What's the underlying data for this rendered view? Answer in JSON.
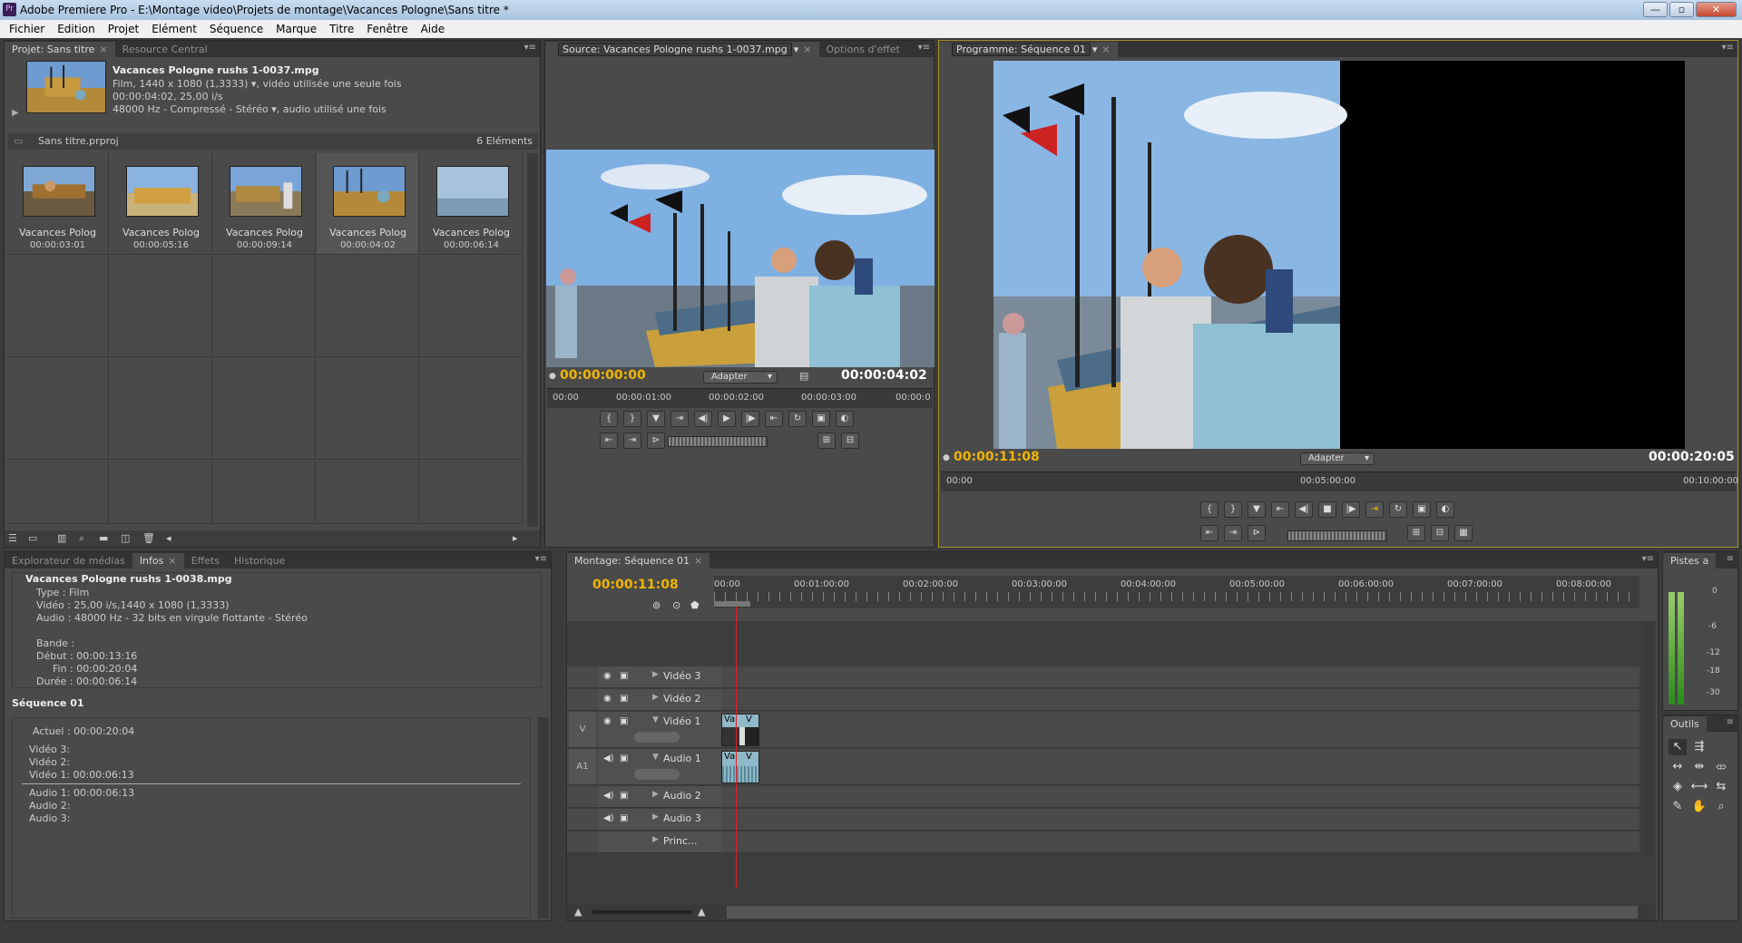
{
  "app_title": "Adobe Premiere Pro - E:\\Montage video\\Projets de montage\\Vacances Pologne\\Sans titre *",
  "app_icon": "Pr",
  "window_buttons": {
    "minimize": "—",
    "maximize": "▫",
    "close": "✕"
  },
  "menu": [
    "Fichier",
    "Edition",
    "Projet",
    "Elément",
    "Séquence",
    "Marque",
    "Titre",
    "Fenêtre",
    "Aide"
  ],
  "project": {
    "tabs": [
      "Projet: Sans titre",
      "Resource Central"
    ],
    "clip_name": "Vacances Pologne rushs 1-0037.mpg",
    "clip_line1": "Film, 1440 x 1080 (1,3333)",
    "clip_line1b": ", vidéo utilisée une seule fois",
    "clip_line2": "00:00:04:02, 25,00 i/s",
    "clip_line3": "48000 Hz - Compressé - Stéréo",
    "clip_line3b": ", audio utilisé une fois",
    "file": "Sans titre.prproj",
    "count": "6 Eléments",
    "items": [
      {
        "name": "Vacances Polog",
        "dur": "00:00:03:01"
      },
      {
        "name": "Vacances Polog",
        "dur": "00:00:05:16"
      },
      {
        "name": "Vacances Polog",
        "dur": "00:00:09:14"
      },
      {
        "name": "Vacances Polog",
        "dur": "00:00:04:02"
      },
      {
        "name": "Vacances Polog",
        "dur": "00:00:06:14"
      }
    ]
  },
  "source": {
    "tab": "Source: Vacances Pologne rushs 1-0037.mpg",
    "tab2": "Options d'effet",
    "tc_current": "00:00:00:00",
    "fit": "Adapter",
    "tc_duration": "00:00:04:02",
    "ruler": [
      "00:00",
      "00:00:01:00",
      "00:00:02:00",
      "00:00:03:00",
      "00:00:0"
    ]
  },
  "program": {
    "tab": "Programme: Séquence 01",
    "tc_current": "00:00:11:08",
    "fit": "Adapter",
    "tc_duration": "00:00:20:05",
    "ruler": [
      "00:00",
      "00:05:00:00",
      "00:10:00:00"
    ]
  },
  "info": {
    "tabs": [
      "Explorateur de médias",
      "Infos",
      "Effets",
      "Historique"
    ],
    "clip_name": "Vacances Pologne rushs 1-0038.mpg",
    "lines": [
      "Type : Film",
      "Vidéo : 25,00 i/s,1440 x 1080 (1,3333)",
      "Audio : 48000 Hz - 32 bits en virgule flottante - Stéréo",
      "",
      "Bande :",
      "Début : 00:00:13:16",
      "Fin : 00:00:20:04",
      "Durée : 00:00:06:14"
    ],
    "sequence": "Séquence 01",
    "seq_lines": [
      "Actuel : 00:00:20:04",
      "",
      "Vidéo 3:",
      "Vidéo 2:",
      "Vidéo 1: 00:00:06:13"
    ],
    "seq_audio": [
      "Audio 1: 00:00:06:13",
      "Audio 2:",
      "Audio 3:"
    ]
  },
  "timeline": {
    "tab": "Montage: Séquence 01",
    "tc": "00:00:11:08",
    "ruler": [
      "00:00",
      "00:01:00:00",
      "00:02:00:00",
      "00:03:00:00",
      "00:04:00:00",
      "00:05:00:00",
      "00:06:00:00",
      "00:07:00:00",
      "00:08:00:00"
    ],
    "tracks": [
      {
        "name": "Vidéo 3",
        "type": "video"
      },
      {
        "name": "Vidéo 2",
        "type": "video"
      },
      {
        "name": "Vidéo 1",
        "type": "video",
        "target": "V"
      },
      {
        "name": "Audio 1",
        "type": "audio",
        "target": "A1"
      },
      {
        "name": "Audio 2",
        "type": "audio"
      },
      {
        "name": "Audio 3",
        "type": "audio"
      },
      {
        "name": "Princ...",
        "type": "master"
      }
    ],
    "clip_label": "Va",
    "clip_label2": "V"
  },
  "meters": {
    "tab": "Pistes a",
    "scale": [
      "0",
      "-6",
      "-12",
      "-18",
      "-30"
    ]
  },
  "tools": {
    "tab": "Outils"
  },
  "colors": {
    "accent": "#f0b400",
    "playhead": "#e02020",
    "clip": "#8fb8c8"
  }
}
